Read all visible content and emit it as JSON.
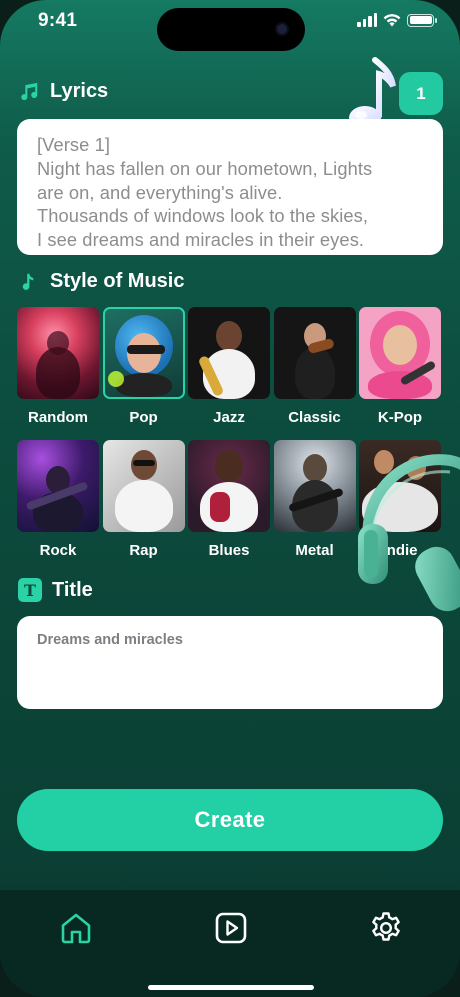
{
  "status_bar": {
    "time": "9:41"
  },
  "lyrics": {
    "heading": "Lyrics",
    "count_badge": "1",
    "lines": [
      "[Verse 1]",
      "Night has fallen on our hometown, Lights",
      "are on, and everything's alive.",
      "Thousands of windows look to the skies,",
      "I see dreams and miracles in their eyes."
    ]
  },
  "style": {
    "heading": "Style of Music",
    "selected": "Pop",
    "items": [
      {
        "label": "Random"
      },
      {
        "label": "Pop"
      },
      {
        "label": "Jazz"
      },
      {
        "label": "Classic"
      },
      {
        "label": "K-Pop"
      },
      {
        "label": "Rock"
      },
      {
        "label": "Rap"
      },
      {
        "label": "Blues"
      },
      {
        "label": "Metal"
      },
      {
        "label": "Indie"
      }
    ]
  },
  "title": {
    "heading": "Title",
    "value": "Dreams and miracles"
  },
  "create_button": {
    "label": "Create"
  },
  "tabbar": {
    "items": [
      "home-icon",
      "play-icon",
      "gear-icon"
    ],
    "active": "home-icon"
  },
  "colors": {
    "accent": "#23cfa5",
    "background": "#0c4b3d",
    "tabbar": "#082822"
  }
}
